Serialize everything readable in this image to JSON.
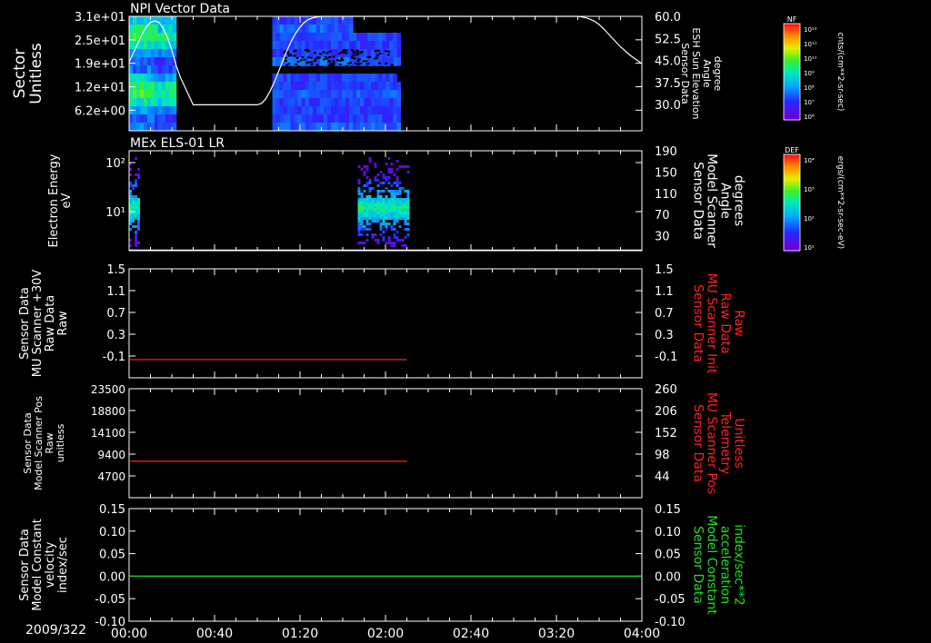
{
  "date_label": "2009/322",
  "colors": {
    "white": "#ffffff",
    "red": "#ff2020",
    "green": "#22dd22",
    "background": "#000000"
  },
  "time_axis": {
    "range_min": [
      0,
      240
    ],
    "ticks": [
      "00:00",
      "00:40",
      "01:20",
      "02:00",
      "02:40",
      "03:20",
      "04:00"
    ]
  },
  "chart_data": [
    {
      "type": "heatmap",
      "title": "NPI Vector Data",
      "ylabel": [
        "Sector",
        "Unitless"
      ],
      "yticks": [
        "3.1e+01",
        "2.5e+01",
        "1.9e+01",
        "1.2e+01",
        "6.2e+00"
      ],
      "ylim": [
        0,
        31
      ],
      "y2label": [
        "Sensor Data",
        "ESH Sun Elevation",
        "Angle",
        "degree"
      ],
      "y2ticks": [
        "60.0",
        "52.5",
        "45.0",
        "37.5",
        "30.0"
      ],
      "y2lim": [
        22.5,
        60
      ],
      "data_intervals_min": [
        [
          0,
          22
        ],
        [
          67,
          127
        ]
      ],
      "colorbar": {
        "label": "NF",
        "units": "cnts/(cm**2-sr-sec)",
        "ticks": [
          "10¹²",
          "10¹¹",
          "10¹⁰",
          "10⁹",
          "10⁸",
          "10⁷",
          "10⁶"
        ],
        "range_log10": [
          6,
          12
        ]
      },
      "series": [
        {
          "name": "ESH Sun Elevation Angle",
          "x": [
            0,
            2,
            4,
            6,
            8,
            10,
            12,
            14,
            16,
            18,
            20,
            22,
            24,
            30,
            40,
            50,
            60,
            62,
            64,
            66,
            68,
            70,
            72,
            74,
            76,
            78,
            80,
            82,
            84,
            86,
            88,
            90,
            95,
            100,
            110,
            120,
            130,
            140,
            150,
            160,
            170,
            180,
            190,
            200,
            210,
            212,
            214,
            216,
            218,
            220,
            222,
            224,
            226,
            228,
            230,
            232,
            234,
            236,
            238,
            240
          ],
          "y": [
            45,
            48,
            51,
            54,
            56.5,
            58,
            58.5,
            58,
            56,
            53,
            49,
            44,
            40,
            31,
            31,
            31,
            31,
            31.5,
            33,
            35.5,
            38.5,
            42,
            45.5,
            49,
            52,
            54.5,
            56.5,
            58,
            59,
            59.5,
            59.8,
            60,
            60,
            60,
            60,
            60,
            60,
            60,
            60,
            60,
            60,
            60,
            60,
            60,
            60,
            59.8,
            59.5,
            59,
            58.3,
            57.3,
            56,
            54.5,
            53,
            51.5,
            50,
            48.8,
            47.5,
            46.5,
            45.5,
            44.5
          ]
        }
      ]
    },
    {
      "type": "heatmap",
      "title": "MEx ELS-01 LR",
      "ylabel": [
        "Electron Energy",
        "eV"
      ],
      "yticks": [
        "10²",
        "10¹"
      ],
      "ylim_log10": [
        0.35,
        2.25
      ],
      "y2label": [
        "Sensor Data",
        "Model Scanner",
        "Angle",
        "degrees"
      ],
      "y2ticks": [
        "190",
        "150",
        "110",
        "70",
        "30"
      ],
      "y2lim": [
        10,
        190
      ],
      "data_intervals_min": [
        [
          0,
          4
        ],
        [
          107,
          130
        ]
      ],
      "colorbar": {
        "label": "DEF",
        "units": "ergs/(cm**2-sr-sec-eV)",
        "ticks": [
          "10⁴",
          "10³",
          "10²",
          "10¹"
        ],
        "range_log10": [
          1,
          4
        ]
      },
      "series": [
        {
          "name": "Model Scanner Angle",
          "x": [
            0,
            240
          ],
          "y": [
            11,
            11
          ]
        }
      ]
    },
    {
      "type": "line",
      "ylabel": [
        "Sensor Data",
        "MU Scanner +30V",
        "Raw Data",
        "Raw"
      ],
      "yticks": [
        "1.5",
        "1.1",
        "0.7",
        "0.3",
        "-0.1"
      ],
      "ylim": [
        -0.3,
        1.5
      ],
      "y2label": [
        "Sensor Data",
        "MU Scanner Init",
        "Raw Data",
        "Raw"
      ],
      "y2ticks": [
        "1.5",
        "1.1",
        "0.7",
        "0.3",
        "-0.1"
      ],
      "y2lim": [
        -0.3,
        1.5
      ],
      "series": [
        {
          "name": "MU Scanner Init",
          "x": [
            0,
            130
          ],
          "y": [
            0.0,
            0.0
          ]
        }
      ]
    },
    {
      "type": "line",
      "ylabel": [
        "Sensor Data",
        "Model Scanner Pos",
        "Raw",
        "unitless"
      ],
      "yticks": [
        "23500",
        "18800",
        "14100",
        "9400",
        "4700"
      ],
      "ylim": [
        0,
        23500
      ],
      "y2label": [
        "Sensor Data",
        "MU Scanner Pos",
        "Telemetry",
        "Unitless"
      ],
      "y2ticks": [
        "260",
        "206",
        "152",
        "98",
        "44"
      ],
      "y2lim": [
        0,
        260
      ],
      "series": [
        {
          "name": "Model Scanner Pos",
          "x": [
            0,
            130
          ],
          "y": [
            7850,
            7850
          ]
        }
      ]
    },
    {
      "type": "line",
      "ylabel": [
        "Sensor Data",
        "Model Constant",
        "velocity",
        "index/sec"
      ],
      "yticks": [
        "0.15",
        "0.10",
        "0.05",
        "0.00",
        "-0.05",
        "-0.10"
      ],
      "ylim": [
        -0.1,
        0.15
      ],
      "y2label": [
        "Sensor Data",
        "Model Constant",
        "acceleration",
        "index/sec**2"
      ],
      "y2ticks": [
        "0.15",
        "0.10",
        "0.05",
        "0.00",
        "-0.05",
        "-0.10"
      ],
      "y2lim": [
        -0.1,
        0.15
      ],
      "series": [
        {
          "name": "Model Constant acceleration",
          "x": [
            0,
            240
          ],
          "y": [
            0.0,
            0.0
          ]
        }
      ]
    }
  ]
}
